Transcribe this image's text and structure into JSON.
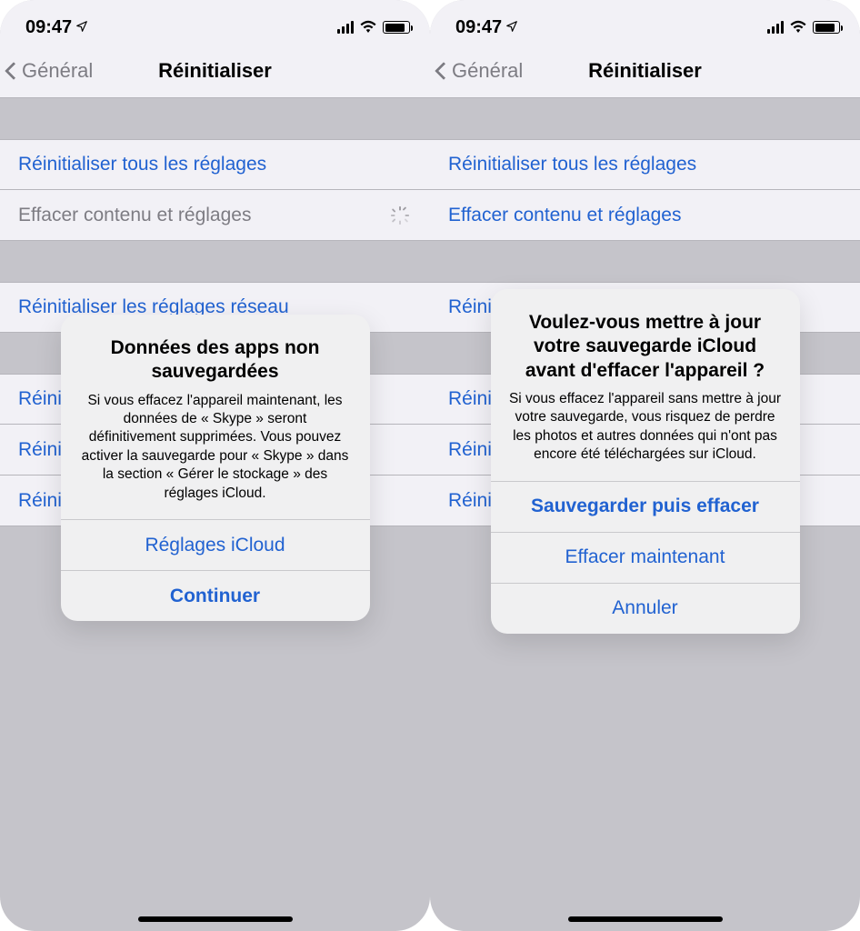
{
  "status": {
    "time": "09:47"
  },
  "nav": {
    "back": "Général",
    "title": "Réinitialiser"
  },
  "cells": {
    "reset_all": "Réinitialiser tous les réglages",
    "erase_all": "Effacer contenu et réglages",
    "reset_network": "Réinitialiser les réglages réseau",
    "partial1": "Réini",
    "partial2": "Réini",
    "partial3": "Réini"
  },
  "alert1": {
    "title": "Données des apps non sauvegardées",
    "body": "Si vous effacez l'appareil maintenant, les données de « Skype » seront définitivement supprimées. Vous pouvez activer la sauvegarde pour « Skype » dans la section « Gérer le stockage » des réglages iCloud.",
    "btn1": "Réglages iCloud",
    "btn2": "Continuer"
  },
  "alert2": {
    "title": "Voulez-vous mettre à jour votre sauvegarde iCloud avant d'effacer l'appareil ?",
    "body": "Si vous effacez l'appareil sans mettre à jour votre sauvegarde, vous risquez de perdre les photos et autres données qui n'ont pas encore été téléchargées sur iCloud.",
    "btn1": "Sauvegarder puis effacer",
    "btn2": "Effacer maintenant",
    "btn3": "Annuler"
  }
}
